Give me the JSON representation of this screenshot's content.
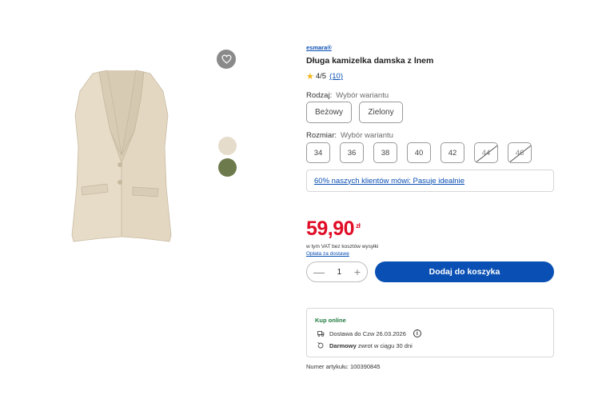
{
  "product": {
    "brand": "esmara®",
    "title": "Długa kamizelka damska z lnem",
    "rating": "4/5",
    "review_count": "(10)",
    "rating_value": 4,
    "rating_max": 5
  },
  "variant": {
    "label": "Rodzaj:",
    "hint": "Wybór wariantu",
    "options": [
      "Beżowy",
      "Zielony"
    ]
  },
  "size": {
    "label": "Rozmiar:",
    "hint": "Wybór wariantu",
    "options": [
      {
        "label": "34",
        "available": true
      },
      {
        "label": "36",
        "available": true
      },
      {
        "label": "38",
        "available": true
      },
      {
        "label": "40",
        "available": true
      },
      {
        "label": "42",
        "available": true
      },
      {
        "label": "44",
        "available": false
      },
      {
        "label": "46",
        "available": false
      }
    ]
  },
  "fit_text": "60% naszych klientów mówi: Pasuje idealnie",
  "price": {
    "value": "59,90",
    "currency": "zł",
    "vat_note": "w tym VAT bez kosztów wysyłki",
    "shipping_link": "Opłata za dostawę"
  },
  "cart": {
    "quantity": "1",
    "minus": "—",
    "plus": "+",
    "add_label": "Dodaj do koszyka"
  },
  "delivery": {
    "heading": "Kup online",
    "delivery_text": "Dostawa do Czw 26.03.2026",
    "return_bold": "Darmowy",
    "return_text": "zwrot w ciągu 30 dni"
  },
  "article": "Numer artykułu: 100390845",
  "colors": {
    "accent": "#0a50b4",
    "price": "#e00d26",
    "swatch_beige": "#e6dccb",
    "swatch_green": "#6d7a4c",
    "online_green": "#1e7a3e"
  },
  "icons": {
    "wishlist": "heart-icon",
    "star": "star-icon",
    "delivery": "delivery-icon",
    "return": "return-icon",
    "info": "info-icon"
  }
}
